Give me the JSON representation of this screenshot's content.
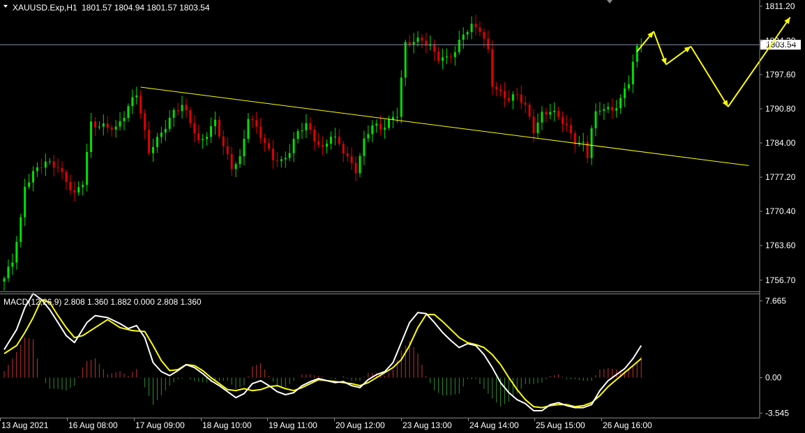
{
  "header": {
    "symbol": "XAUUSD.Exp,H1",
    "ohlc": "1801.57 1804.94 1801.57 1803.54"
  },
  "macd": {
    "label": "MACD(12,26,9) 2.808 1.360 1.882 0.000 2.808 1.360"
  },
  "colors": {
    "background": "#000000",
    "bull": "#00e000",
    "bear": "#e00000",
    "trendline": "#ffff00",
    "arrow": "#ffff00",
    "macd_main": "#ffffff",
    "macd_signal": "#ffff00"
  },
  "chart_data": [
    {
      "type": "candlestick",
      "symbol": "XAUUSD.Exp",
      "timeframe": "H1",
      "price_axis_ticks": [
        "1811.20",
        "1804.30",
        "1797.60",
        "1790.80",
        "1784.00",
        "1777.20",
        "1770.40",
        "1763.60",
        "1756.70"
      ],
      "ylim": [
        1754.6,
        1812.3
      ],
      "current_price": "1803.54",
      "time_axis_ticks": [
        "13 Aug 2021",
        "16 Aug 08:00",
        "17 Aug 09:00",
        "18 Aug 10:00",
        "19 Aug 11:00",
        "20 Aug 12:00",
        "23 Aug 13:00",
        "24 Aug 14:00",
        "25 Aug 15:00",
        "26 Aug 16:00"
      ],
      "close_path": [
        [
          0,
          1756.8
        ],
        [
          2,
          1760.5
        ],
        [
          4,
          1769.0
        ],
        [
          5,
          1775.6
        ],
        [
          7,
          1778.0
        ],
        [
          10,
          1780.0
        ],
        [
          13,
          1779.5
        ],
        [
          15,
          1776.5
        ],
        [
          17,
          1773.5
        ],
        [
          19,
          1776.0
        ],
        [
          21,
          1788.0
        ],
        [
          24,
          1787.5
        ],
        [
          27,
          1786.5
        ],
        [
          29,
          1789.5
        ],
        [
          31,
          1793.0
        ],
        [
          32,
          1794.2
        ],
        [
          34,
          1786.0
        ],
        [
          35,
          1782.0
        ],
        [
          37,
          1784.5
        ],
        [
          39,
          1787.5
        ],
        [
          41,
          1790.5
        ],
        [
          43,
          1791.5
        ],
        [
          45,
          1788.0
        ],
        [
          47,
          1784.0
        ],
        [
          49,
          1786.0
        ],
        [
          51,
          1788.5
        ],
        [
          53,
          1783.0
        ],
        [
          55,
          1779.0
        ],
        [
          57,
          1781.0
        ],
        [
          59,
          1789.5
        ],
        [
          61,
          1787.0
        ],
        [
          63,
          1783.5
        ],
        [
          65,
          1781.0
        ],
        [
          67,
          1780.5
        ],
        [
          69,
          1782.5
        ],
        [
          71,
          1786.0
        ],
        [
          73,
          1787.5
        ],
        [
          75,
          1785.0
        ],
        [
          77,
          1783.0
        ],
        [
          79,
          1785.5
        ],
        [
          81,
          1783.5
        ],
        [
          83,
          1781.0
        ],
        [
          85,
          1778.8
        ],
        [
          87,
          1784.5
        ],
        [
          89,
          1787.5
        ],
        [
          91,
          1786.5
        ],
        [
          93,
          1788.5
        ],
        [
          95,
          1790.0
        ],
        [
          96,
          1797.0
        ],
        [
          97,
          1803.5
        ],
        [
          99,
          1804.0
        ],
        [
          101,
          1804.5
        ],
        [
          103,
          1803.5
        ],
        [
          105,
          1801.0
        ],
        [
          107,
          1800.5
        ],
        [
          109,
          1802.0
        ],
        [
          111,
          1806.0
        ],
        [
          113,
          1807.5
        ],
        [
          115,
          1806.5
        ],
        [
          117,
          1802.0
        ],
        [
          118,
          1795.5
        ],
        [
          120,
          1794.0
        ],
        [
          122,
          1793.0
        ],
        [
          124,
          1793.5
        ],
        [
          126,
          1791.0
        ],
        [
          128,
          1786.5
        ],
        [
          130,
          1790.0
        ],
        [
          132,
          1790.5
        ],
        [
          134,
          1789.0
        ],
        [
          136,
          1787.0
        ],
        [
          138,
          1784.5
        ],
        [
          140,
          1784.0
        ],
        [
          141,
          1781.5
        ],
        [
          142,
          1787.0
        ],
        [
          143,
          1789.5
        ],
        [
          145,
          1791.0
        ],
        [
          147,
          1790.5
        ],
        [
          149,
          1793.0
        ],
        [
          151,
          1796.0
        ],
        [
          152,
          1800.0
        ],
        [
          153,
          1802.5
        ],
        [
          154,
          1803.5
        ]
      ],
      "trendline": [
        [
          33,
          1795.1
        ],
        [
          180,
          1779.5
        ]
      ],
      "forecast_arrows": [
        [
          153,
          1802.2
        ],
        [
          157,
          1806.2
        ],
        [
          160,
          1799.6
        ],
        [
          166,
          1803.2
        ],
        [
          175,
          1791.2
        ],
        [
          190,
          1809.0
        ]
      ]
    },
    {
      "type": "line",
      "name": "MACD(12,26,9)",
      "axis_ticks": [
        "7.665",
        "0.00",
        "-3.545"
      ],
      "ylim": [
        -4.0,
        8.4
      ],
      "main": [
        [
          0,
          2.8
        ],
        [
          3,
          4.8
        ],
        [
          5,
          7.0
        ],
        [
          7,
          8.4
        ],
        [
          9,
          7.8
        ],
        [
          11,
          6.8
        ],
        [
          13,
          5.5
        ],
        [
          15,
          4.2
        ],
        [
          17,
          3.5
        ],
        [
          20,
          5.5
        ],
        [
          22,
          6.2
        ],
        [
          25,
          6.0
        ],
        [
          28,
          5.4
        ],
        [
          30,
          4.9
        ],
        [
          32,
          5.2
        ],
        [
          34,
          4.0
        ],
        [
          36,
          1.5
        ],
        [
          38,
          0.6
        ],
        [
          40,
          0.2
        ],
        [
          42,
          0.7
        ],
        [
          44,
          1.3
        ],
        [
          46,
          1.0
        ],
        [
          48,
          0.4
        ],
        [
          50,
          -0.3
        ],
        [
          52,
          -0.8
        ],
        [
          54,
          -1.4
        ],
        [
          56,
          -2.0
        ],
        [
          58,
          -1.6
        ],
        [
          60,
          -0.6
        ],
        [
          62,
          -0.3
        ],
        [
          64,
          -0.8
        ],
        [
          66,
          -1.4
        ],
        [
          68,
          -1.7
        ],
        [
          70,
          -1.5
        ],
        [
          72,
          -0.8
        ],
        [
          74,
          -0.4
        ],
        [
          76,
          -0.1
        ],
        [
          78,
          -0.3
        ],
        [
          80,
          -0.5
        ],
        [
          82,
          -0.4
        ],
        [
          84,
          -0.8
        ],
        [
          86,
          -1.0
        ],
        [
          88,
          -0.2
        ],
        [
          90,
          0.3
        ],
        [
          92,
          0.6
        ],
        [
          94,
          1.5
        ],
        [
          96,
          3.5
        ],
        [
          98,
          5.5
        ],
        [
          100,
          6.5
        ],
        [
          102,
          6.4
        ],
        [
          104,
          5.5
        ],
        [
          106,
          4.5
        ],
        [
          108,
          3.7
        ],
        [
          110,
          3.0
        ],
        [
          112,
          3.4
        ],
        [
          114,
          3.2
        ],
        [
          116,
          2.3
        ],
        [
          118,
          1.0
        ],
        [
          120,
          -0.5
        ],
        [
          122,
          -1.5
        ],
        [
          124,
          -2.2
        ],
        [
          126,
          -2.6
        ],
        [
          128,
          -3.3
        ],
        [
          130,
          -3.3
        ],
        [
          132,
          -2.7
        ],
        [
          134,
          -2.5
        ],
        [
          136,
          -2.8
        ],
        [
          138,
          -3.0
        ],
        [
          140,
          -3.0
        ],
        [
          142,
          -2.7
        ],
        [
          144,
          -1.3
        ],
        [
          146,
          -0.3
        ],
        [
          148,
          0.3
        ],
        [
          150,
          0.9
        ],
        [
          152,
          1.9
        ],
        [
          154,
          3.2
        ]
      ],
      "signal": [
        [
          0,
          2.4
        ],
        [
          3,
          3.2
        ],
        [
          5,
          4.5
        ],
        [
          7,
          6.0
        ],
        [
          9,
          7.8
        ],
        [
          11,
          7.5
        ],
        [
          13,
          6.2
        ],
        [
          15,
          5.0
        ],
        [
          17,
          4.0
        ],
        [
          19,
          4.2
        ],
        [
          22,
          5.0
        ],
        [
          25,
          5.8
        ],
        [
          28,
          5.0
        ],
        [
          31,
          4.7
        ],
        [
          34,
          4.6
        ],
        [
          36,
          3.2
        ],
        [
          38,
          1.7
        ],
        [
          40,
          0.7
        ],
        [
          42,
          0.8
        ],
        [
          44,
          1.3
        ],
        [
          46,
          1.2
        ],
        [
          48,
          0.7
        ],
        [
          50,
          0.0
        ],
        [
          52,
          -0.6
        ],
        [
          54,
          -1.2
        ],
        [
          56,
          -1.3
        ],
        [
          58,
          -1.1
        ],
        [
          60,
          -1.3
        ],
        [
          62,
          -1.2
        ],
        [
          64,
          -0.9
        ],
        [
          66,
          -0.8
        ],
        [
          68,
          -1.1
        ],
        [
          70,
          -1.3
        ],
        [
          72,
          -1.0
        ],
        [
          74,
          -0.6
        ],
        [
          76,
          -0.2
        ],
        [
          78,
          -0.3
        ],
        [
          80,
          -0.4
        ],
        [
          82,
          -0.5
        ],
        [
          84,
          -0.6
        ],
        [
          86,
          -0.8
        ],
        [
          88,
          -0.5
        ],
        [
          90,
          0.0
        ],
        [
          92,
          0.5
        ],
        [
          94,
          1.0
        ],
        [
          96,
          1.8
        ],
        [
          98,
          3.2
        ],
        [
          100,
          5.0
        ],
        [
          102,
          6.3
        ],
        [
          104,
          6.3
        ],
        [
          106,
          5.6
        ],
        [
          108,
          4.8
        ],
        [
          110,
          4.0
        ],
        [
          112,
          3.5
        ],
        [
          114,
          3.3
        ],
        [
          116,
          3.0
        ],
        [
          118,
          2.3
        ],
        [
          120,
          1.3
        ],
        [
          122,
          0.0
        ],
        [
          124,
          -1.2
        ],
        [
          126,
          -2.2
        ],
        [
          128,
          -2.9
        ],
        [
          130,
          -3.0
        ],
        [
          132,
          -2.8
        ],
        [
          134,
          -2.7
        ],
        [
          136,
          -2.7
        ],
        [
          138,
          -2.9
        ],
        [
          140,
          -2.8
        ],
        [
          142,
          -2.5
        ],
        [
          144,
          -1.8
        ],
        [
          146,
          -0.9
        ],
        [
          148,
          -0.2
        ],
        [
          150,
          0.5
        ],
        [
          152,
          1.2
        ],
        [
          154,
          1.9
        ]
      ]
    }
  ]
}
